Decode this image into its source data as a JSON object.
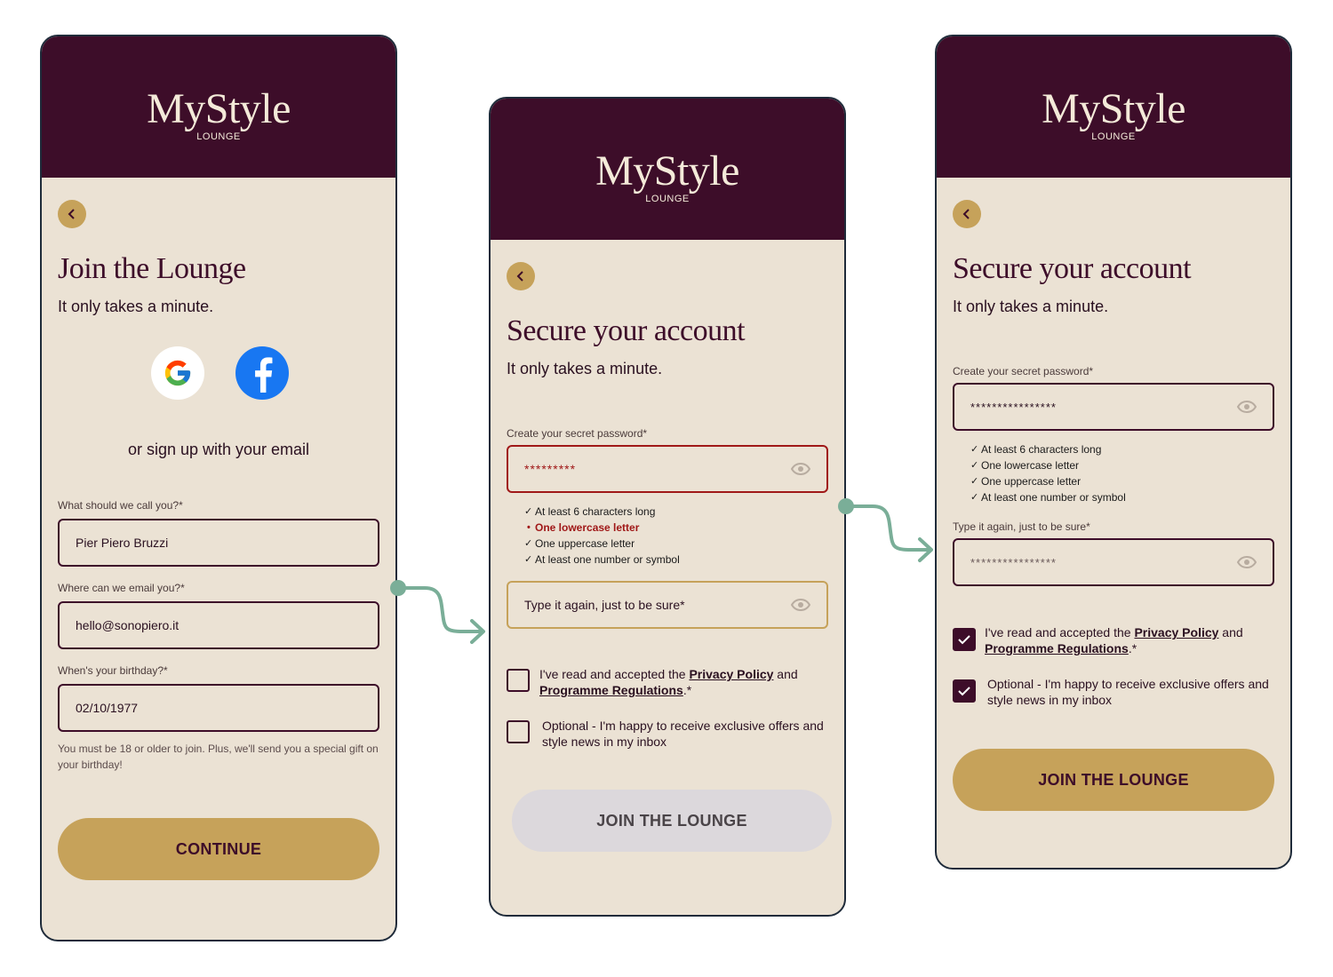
{
  "brand": {
    "name": "MyStyle",
    "sub": "LOUNGE"
  },
  "screen1": {
    "title": "Join the Lounge",
    "subtitle": "It only takes a minute.",
    "social": [
      "google-icon",
      "facebook-icon"
    ],
    "or_text": "or sign up with your email",
    "name_label": "What should we call you?*",
    "name_value": "Pier Piero Bruzzi",
    "email_label": "Where can we email you?*",
    "email_value": "hello@sonopiero.it",
    "birthday_label": "When's your birthday?*",
    "birthday_value": "02/10/1977",
    "helper": "You must be 18 or older to join. Plus, we'll send you a special gift on your birthday!",
    "cta": "CONTINUE"
  },
  "screen2": {
    "title": "Secure your account",
    "subtitle": "It only takes a minute.",
    "password_label": "Create your secret password*",
    "password_value": "*********",
    "requirements": [
      {
        "text": "At least 6 characters long",
        "ok": true
      },
      {
        "text": "One lowercase letter",
        "ok": false
      },
      {
        "text": "One uppercase letter",
        "ok": true
      },
      {
        "text": "At least one number or symbol",
        "ok": true
      }
    ],
    "confirm_placeholder": "Type it again, just to be sure*",
    "terms_prefix": "I've read and accepted the ",
    "terms_link1": "Privacy Policy",
    "terms_mid": " and",
    "terms_link2": "Programme Regulations",
    "terms_suffix": ".*",
    "terms_checked": false,
    "optin_text": "Optional - I'm happy to receive exclusive offers and style news in my inbox",
    "optin_checked": false,
    "cta": "JOIN THE LOUNGE"
  },
  "screen3": {
    "title": "Secure your account",
    "subtitle": "It only takes a minute.",
    "password_label": "Create your secret password*",
    "password_value": "****************",
    "requirements": [
      {
        "text": "At least 6 characters long",
        "ok": true
      },
      {
        "text": "One lowercase letter",
        "ok": true
      },
      {
        "text": "One uppercase letter",
        "ok": true
      },
      {
        "text": "At least one number or symbol",
        "ok": true
      }
    ],
    "confirm_label": "Type it again, just to be sure*",
    "confirm_value": "****************",
    "terms_prefix": "I've read and accepted the ",
    "terms_link1": "Privacy Policy",
    "terms_mid": " and",
    "terms_link2": "Programme Regulations",
    "terms_suffix": ".*",
    "terms_checked": true,
    "optin_text": "Optional - I'm happy to receive exclusive offers and style news in my inbox",
    "optin_checked": true,
    "cta": "JOIN THE LOUNGE"
  },
  "colors": {
    "header": "#3d0d29",
    "background": "#ebe2d4",
    "accent_gold": "#c6a25a",
    "error": "#a01818",
    "disabled": "#dcd8dc",
    "flow_arrow": "#7aae98"
  }
}
